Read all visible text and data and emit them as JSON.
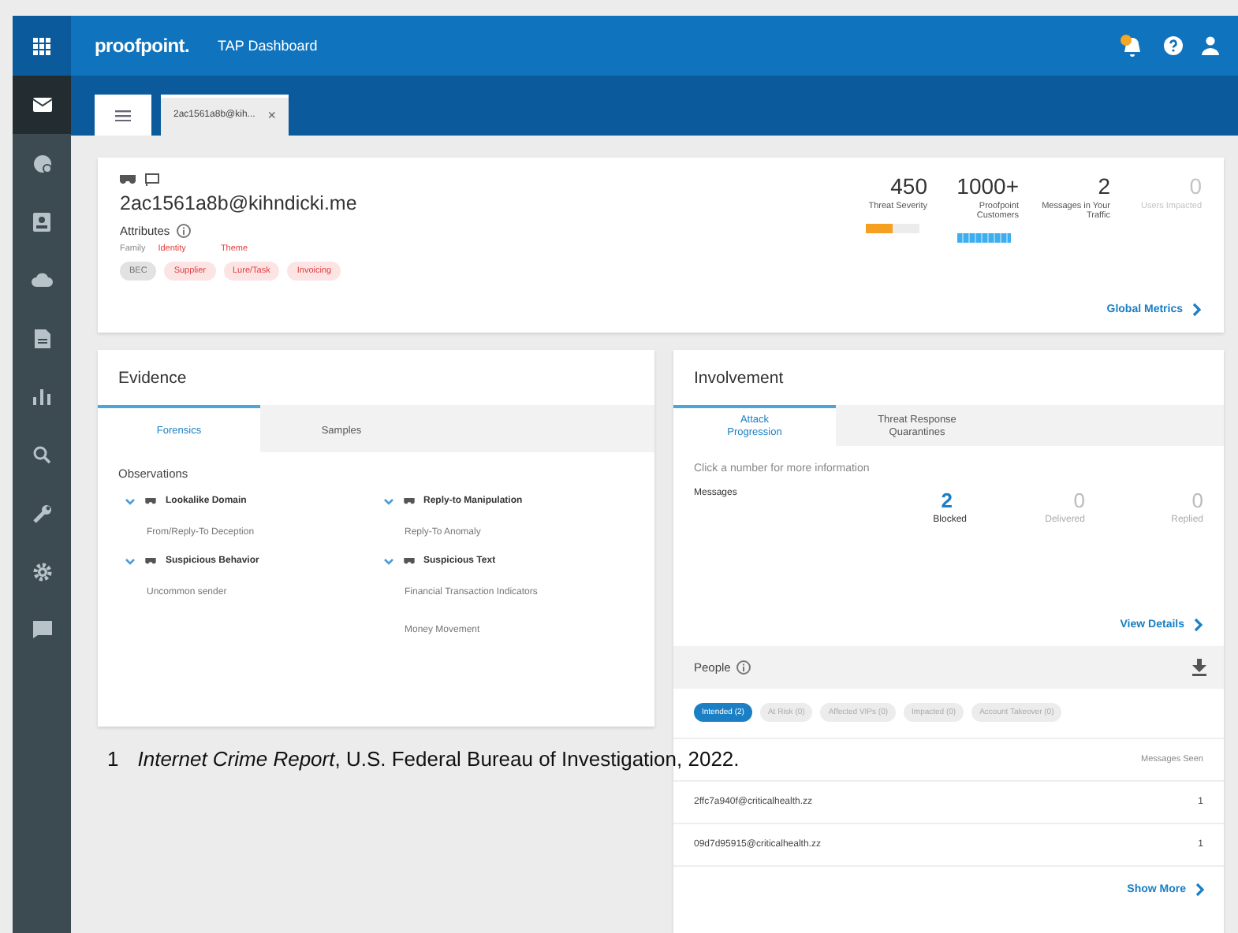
{
  "topbar": {
    "brand": "proofpoint.",
    "title": "TAP Dashboard"
  },
  "sidebar": {
    "items": [
      {
        "selected": true
      },
      {
        "selected": false
      },
      {
        "selected": false
      },
      {
        "selected": false
      },
      {
        "selected": false
      },
      {
        "selected": false
      },
      {
        "selected": false
      },
      {
        "selected": false
      },
      {
        "selected": false
      },
      {
        "selected": false
      }
    ]
  },
  "tabs": [
    {
      "kind": "list",
      "selected": false
    },
    {
      "kind": "page",
      "label": "2ac1561a8b@kih...",
      "close": "×",
      "selected": true
    }
  ],
  "threat": {
    "email": "2ac1561a8b@kihndicki.me",
    "attributes_label": "Attributes",
    "column_labels": [
      {
        "label": "Family",
        "kind": "family"
      },
      {
        "label": "Identity",
        "kind": "identity"
      },
      {
        "label": "Theme",
        "kind": "theme"
      }
    ],
    "chips": [
      {
        "label": "BEC",
        "kind": "family"
      },
      {
        "label": "Supplier",
        "kind": "identity"
      },
      {
        "label": "Lure/Task",
        "kind": "theme"
      },
      {
        "label": "Invoicing",
        "kind": "theme"
      }
    ],
    "metrics": [
      {
        "value": "450",
        "label": "Threat Severity",
        "disabled": false,
        "kind": "severity",
        "level": 0.5
      },
      {
        "value": "1000+",
        "label": "Proofpoint Customers",
        "disabled": false,
        "kind": "customers",
        "level": 1
      },
      {
        "value": "2",
        "label": "Messages in Your Traffic",
        "disabled": false
      },
      {
        "value": "0",
        "label": "Users Impacted",
        "disabled": true
      }
    ],
    "link": "Global Metrics"
  },
  "evidence": {
    "title": "Evidence",
    "tabs": [
      {
        "label": "Forensics",
        "selected": true
      },
      {
        "label": "Samples",
        "selected": false
      }
    ],
    "heading": "Observations",
    "groups": [
      {
        "title": "Lookalike Domain",
        "items": [
          "From/Reply-To Deception"
        ]
      },
      {
        "title": "Reply-to Manipulation",
        "items": [
          "Reply-To Anomaly"
        ]
      },
      {
        "title": "Suspicious Behavior",
        "items": [
          "Uncommon sender"
        ]
      },
      {
        "title": "Suspicious Text",
        "items": [
          "Financial Transaction Indicators",
          "Money Movement"
        ]
      }
    ]
  },
  "involvement": {
    "title": "Involvement",
    "tabs": [
      {
        "label": "Attack Progression",
        "selected": true
      },
      {
        "label": "Threat Response Quarantines",
        "selected": false
      }
    ],
    "hint": "Click a number for more information",
    "row_label": "Messages",
    "counts": [
      {
        "value": "2",
        "label": "Blocked",
        "active": true
      },
      {
        "value": "0",
        "label": "Delivered",
        "active": false
      },
      {
        "value": "0",
        "label": "Replied",
        "active": false
      }
    ],
    "link": "View Details"
  },
  "people": {
    "title": "People",
    "filters": [
      {
        "label": "Intended (2)",
        "selected": true
      },
      {
        "label": "At Risk (0)",
        "selected": false
      },
      {
        "label": "Affected VIPs (0)",
        "selected": false
      },
      {
        "label": "Impacted (0)",
        "selected": false
      },
      {
        "label": "Account Takeover (0)",
        "selected": false
      }
    ],
    "column_2": "Messages Seen",
    "rows": [
      {
        "email": "2ffc7a940f@criticalhealth.zz",
        "count": "1"
      },
      {
        "email": "09d7d95915@criticalhealth.zz",
        "count": "1"
      }
    ],
    "link": "Show More"
  },
  "footnote": {
    "number": "1",
    "text": "*Internet Crime Report*, U.S. Federal Bureau of Investigation, 2022."
  }
}
